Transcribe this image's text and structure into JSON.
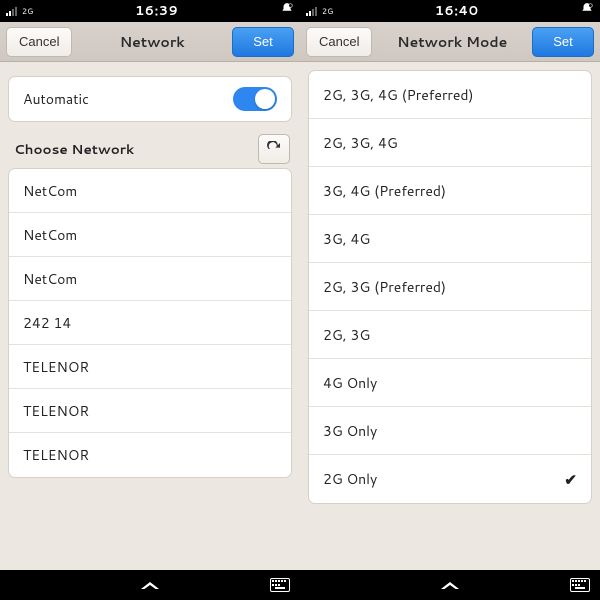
{
  "left": {
    "status": {
      "net": "2G",
      "time": "16:39"
    },
    "header": {
      "cancel": "Cancel",
      "title": "Network",
      "set": "Set"
    },
    "automatic": {
      "label": "Automatic",
      "on": true
    },
    "choose_heading": "Choose Network",
    "networks": [
      "NetCom",
      "NetCom",
      "NetCom",
      "242 14",
      "TELENOR",
      "TELENOR",
      "TELENOR"
    ]
  },
  "right": {
    "status": {
      "net": "2G",
      "time": "16:40"
    },
    "header": {
      "cancel": "Cancel",
      "title": "Network Mode",
      "set": "Set"
    },
    "modes": [
      {
        "label": "2G, 3G, 4G (Preferred)",
        "selected": false
      },
      {
        "label": "2G, 3G, 4G",
        "selected": false
      },
      {
        "label": "3G, 4G (Preferred)",
        "selected": false
      },
      {
        "label": "3G, 4G",
        "selected": false
      },
      {
        "label": "2G, 3G (Preferred)",
        "selected": false
      },
      {
        "label": "2G, 3G",
        "selected": false
      },
      {
        "label": "4G Only",
        "selected": false
      },
      {
        "label": "3G Only",
        "selected": false
      },
      {
        "label": "2G Only",
        "selected": true
      }
    ]
  }
}
